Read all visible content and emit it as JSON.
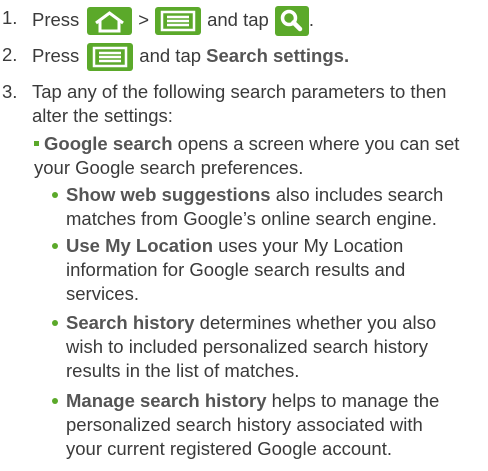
{
  "steps": [
    {
      "num": "1.",
      "parts": {
        "press": "Press",
        "gt": ">",
        "and_tap": "and tap",
        "period": "."
      },
      "icons": [
        "home-key-icon",
        "menu-key-icon",
        "search-icon"
      ]
    },
    {
      "num": "2.",
      "parts": {
        "press": "Press",
        "and_tap": "and tap",
        "bold": "Search settings."
      },
      "icons": [
        "menu-key-icon"
      ]
    },
    {
      "num": "3.",
      "line1": "Tap any of the following search parameters to then",
      "line2": "alter the settings:"
    }
  ],
  "google_search": {
    "bold": "Google search",
    "text1": " opens a screen where you can set",
    "text2": "your Google search preferences."
  },
  "bullets": [
    {
      "bold": "Show web suggestions",
      "lines": [
        " also includes search",
        "matches from Google’s online search engine."
      ]
    },
    {
      "bold": "Use My Location",
      "lines": [
        " uses your My Location",
        "information for Google search results and",
        "services."
      ]
    },
    {
      "bold": "Search history",
      "lines": [
        " determines whether you also",
        "wish to included personalized search history",
        "results in the list of matches."
      ]
    },
    {
      "bold": "Manage search history",
      "lines": [
        " helps to manage the",
        "personalized search history associated with",
        "your current registered Google account."
      ]
    }
  ],
  "colors": {
    "accent": "#5ba92a",
    "text": "#3a3a3a",
    "bold": "#555555"
  }
}
